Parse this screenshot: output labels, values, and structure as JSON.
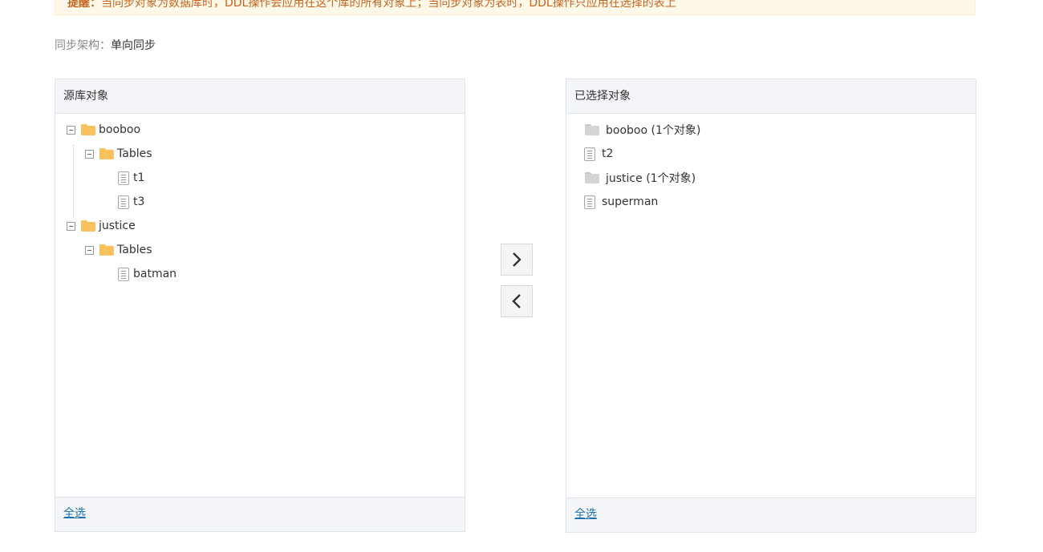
{
  "notice": {
    "prefix": "提醒：",
    "text": "当同步对象为数据库时，DDL操作会应用在这个库的所有对象上；当同步对象为表时，DDL操作只应用在选择的表上"
  },
  "architecture": {
    "label": "同步架构：",
    "value": "单向同步"
  },
  "source_panel": {
    "title": "源库对象",
    "select_all": "全选",
    "tree": {
      "db1": {
        "name": "booboo",
        "tables_label": "Tables",
        "tables": [
          "t1",
          "t3"
        ]
      },
      "db2": {
        "name": "justice",
        "tables_label": "Tables",
        "tables": [
          "batman"
        ]
      }
    }
  },
  "selected_panel": {
    "title": "已选择对象",
    "select_all": "全选",
    "items": [
      {
        "type": "database",
        "label": "booboo (1个对象)"
      },
      {
        "type": "table",
        "label": "t2"
      },
      {
        "type": "database",
        "label": "justice (1个对象)"
      },
      {
        "type": "table",
        "label": "superman"
      }
    ]
  },
  "icons": {
    "move_right": "chevron-right-icon",
    "move_left": "chevron-left-icon",
    "database": "folder-icon",
    "table": "table-document-icon"
  },
  "colors": {
    "notice_text": "#c7621f",
    "notice_bg": "#fdf8e7",
    "link": "#1a6fb5",
    "folder": "#f9c25c",
    "panel_header_bg": "#f4f5f8"
  }
}
